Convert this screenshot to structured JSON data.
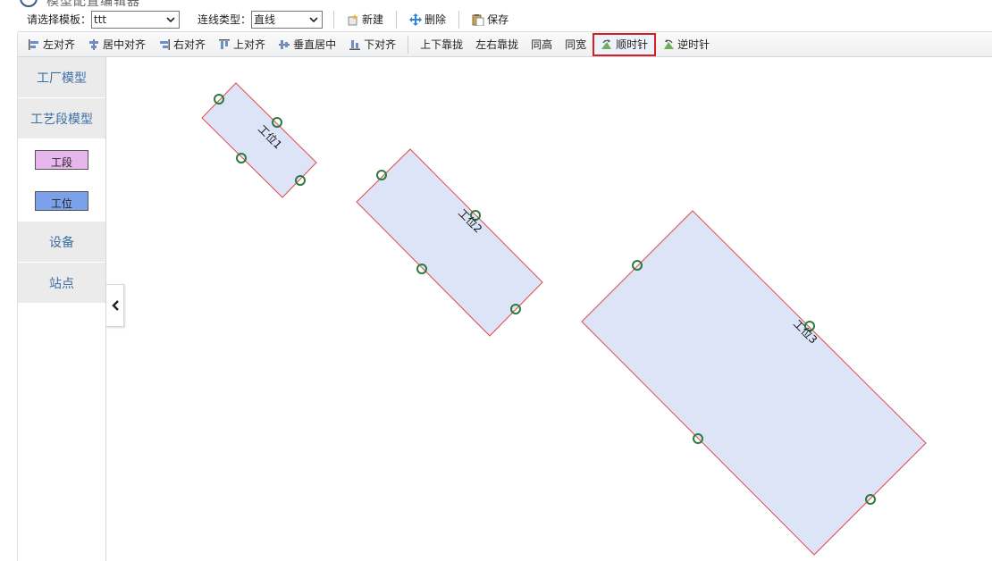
{
  "title": {
    "text": "模型配置编辑器"
  },
  "toolbar1": {
    "template_label": "请选择模板：",
    "template_value": "ttt",
    "line_type_label": "连线类型：",
    "line_type_value": "直线",
    "new_label": "新建",
    "delete_label": "删除",
    "save_label": "保存"
  },
  "toolbar2": {
    "align_left": "左对齐",
    "align_center": "居中对齐",
    "align_right": "右对齐",
    "align_top": "上对齐",
    "align_middle": "垂直居中",
    "align_bottom": "下对齐",
    "dock_vertical": "上下靠拢",
    "dock_horizontal": "左右靠拢",
    "same_height": "同高",
    "same_width": "同宽",
    "rotate_cw": "顺时针",
    "rotate_ccw": "逆时针"
  },
  "sidebar": {
    "items": [
      {
        "label": "工厂模型"
      },
      {
        "label": "工艺段模型"
      },
      {
        "label": "工段",
        "color": "#e6b6ec"
      },
      {
        "label": "工位",
        "color": "#7aa1ea"
      },
      {
        "label": "设备"
      },
      {
        "label": "站点"
      }
    ]
  },
  "canvas": {
    "shape_fill": "#dde4f7",
    "shape_stroke": "#e04a4a",
    "port_color": "#2d7a3f",
    "shapes": [
      {
        "label": "工位1"
      },
      {
        "label": "工位2"
      },
      {
        "label": "工位3"
      }
    ]
  }
}
